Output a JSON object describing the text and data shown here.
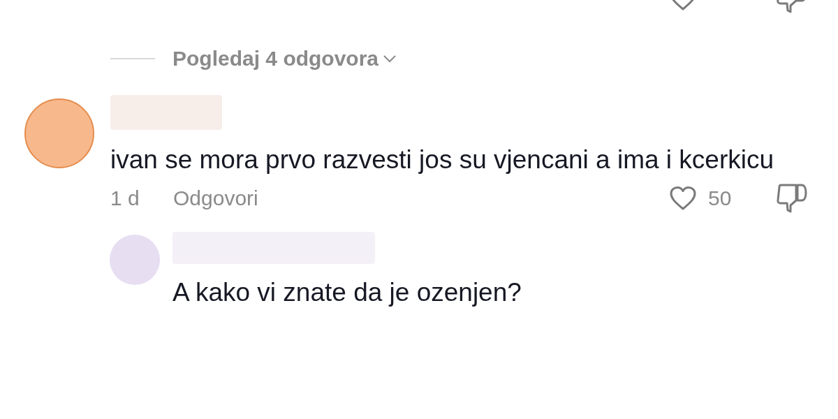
{
  "view_replies": {
    "label": "Pogledaj 4 odgovora"
  },
  "comment": {
    "text": "ivan se mora prvo razvesti jos su vjencani a ima i kcerkicu",
    "time": "1 d",
    "reply_label": "Odgovori",
    "likes": "50"
  },
  "reply": {
    "text": "A kako vi znate da je ozenjen?"
  }
}
